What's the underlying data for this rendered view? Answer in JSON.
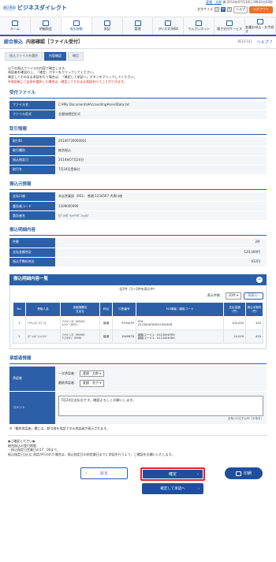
{
  "header": {
    "logo_mark": "あいちの",
    "logo_name": "ビジネスダイレクト",
    "user_name": "愛銀　太郎",
    "user_suffix": "様",
    "last_login": "2014年07月30日 9時30分00秒",
    "font_label": "文字サイズ",
    "font_sizes": [
      "小",
      "中",
      "大"
    ],
    "help_label": "ヘルプ",
    "logout_label": "ログアウト"
  },
  "nav": [
    {
      "label": "ホーム"
    },
    {
      "label": "明細照会"
    },
    {
      "label": "資金移動"
    },
    {
      "label": "承認"
    },
    {
      "label": "管理"
    },
    {
      "label": "がいだれWEB"
    },
    {
      "label": "でんさいネット"
    },
    {
      "label": "電子交付サービス"
    },
    {
      "label": "各種お申込・お手続き"
    }
  ],
  "page": {
    "title1": "総合振込",
    "title2": "内容確認［ファイル受付］",
    "code": "BSGF102",
    "help": "ヘルプ"
  },
  "steps": [
    "振込ファイルを選択",
    "内容確認",
    "確定"
  ],
  "intro": [
    "以下の振込ファイルの内容で確定します。",
    "承認者を確認の上、「確定」ボタンをクリックしてください。",
    "確定してそのまま承認を行う場合は、「確定して承認へ」ボタンをクリックしてください。",
    "※承認者にご自身を選択した場合は、確定してそのまま承認を行うことができます。"
  ],
  "file_section": {
    "title": "受付ファイル",
    "rows": [
      {
        "k": "ファイル名",
        "v": "C:¥My Documents¥Accounting¥sendData.txt"
      },
      {
        "k": "ファイル形式",
        "v": "全銀協規定形式"
      }
    ]
  },
  "torihiki": {
    "title": "取引情報",
    "rows": [
      {
        "k": "取引ID",
        "v": "20140730000001"
      },
      {
        "k": "取引種別",
        "v": "総合振込"
      },
      {
        "k": "振込指定日",
        "v": "2014年07月24日"
      },
      {
        "k": "取引名",
        "v": "7月24日登録分"
      }
    ]
  },
  "furikomimoto": {
    "title": "振込元情報",
    "rows": [
      {
        "k": "支払口座",
        "v": "本店営業部（001） 普通 1234567 代表口座"
      },
      {
        "k": "委託者コード",
        "v": "1309000990"
      },
      {
        "k": "委託者名",
        "v": "ｶﾌﾞｼｷｶﾞｲｼｬｱｲｷﾞﾝｼｮｳｼﾞ"
      }
    ]
  },
  "meisai": {
    "title": "振込明細内容",
    "rows": [
      {
        "k": "件数",
        "v": "2件"
      },
      {
        "k": "支払金額合計",
        "v": "120,000円"
      },
      {
        "k": "振込手数料合計",
        "v": "432円"
      }
    ]
  },
  "list": {
    "title": "振込明細内容一覧",
    "collapse": "−",
    "count_text": "全2件（1〜2件を表示中）",
    "per_page_label": "表示件数：",
    "per_page": "10件",
    "redisplay": "再表示",
    "headers": [
      "No.",
      "受取人名",
      "金融機関名\n支店名",
      "科目",
      "口座番号",
      "EDI情報／顧客コード",
      "支払金額\n（円）",
      "振込手数料\n（円）"
    ],
    "rows": [
      {
        "no": "1",
        "name": "ｱｲﾁｼｮｳｼﾞｶﾌﾞｼｷ",
        "bank": "ｱｲﾁｷﾞﾝｺｳ（0542）\nﾎﾝﾃﾝ（001）",
        "kind": "普通",
        "acct": "9704439",
        "edi": "EDI：\n0123456789012345678",
        "amt": "100,000",
        "fee": "432"
      },
      {
        "no": "2",
        "name": "ｶﾌﾞｼｷｶﾞｲｼｬｴｲﾂｰ",
        "bank": "ｱｲﾁｷﾞﾝｺｳ（9999）\nﾁｭｳｵｳﾃﾝ（999）",
        "kind": "普通",
        "acct": "1969878",
        "edi": "顧客コード1：0123456789\n顧客コード2：0123456789",
        "amt": "20,000",
        "fee": "432"
      }
    ]
  },
  "approver": {
    "title": "承認者情報",
    "label_approver": "承認者",
    "label_comment": "コメント",
    "first_label": "一次承認者：",
    "first_value": "愛銀　太郎",
    "final_label": "最終承認者：",
    "final_value": "愛銀　花子",
    "comment": "7月24日支払分です。確認よろしくお願いします。",
    "comment_count": "全角120文字以内［半角可］"
  },
  "approver_note": "※「最終承認者」欄には、取引限を承認できる承認者が表示されます。",
  "footer_notes": [
    "◆ご確認ください◆",
    "総合振込の受付時限",
    "・振込指定日営業日の17：00まで。",
    "振込指定日当日に承認が行われた場合は、振込指定日の前営業日までに承認を行うよう、ご確認をお願いいたします。"
  ],
  "buttons": {
    "back": "戻る",
    "confirm": "確定",
    "confirm_approve": "確定して承認へ",
    "print": "印刷"
  }
}
